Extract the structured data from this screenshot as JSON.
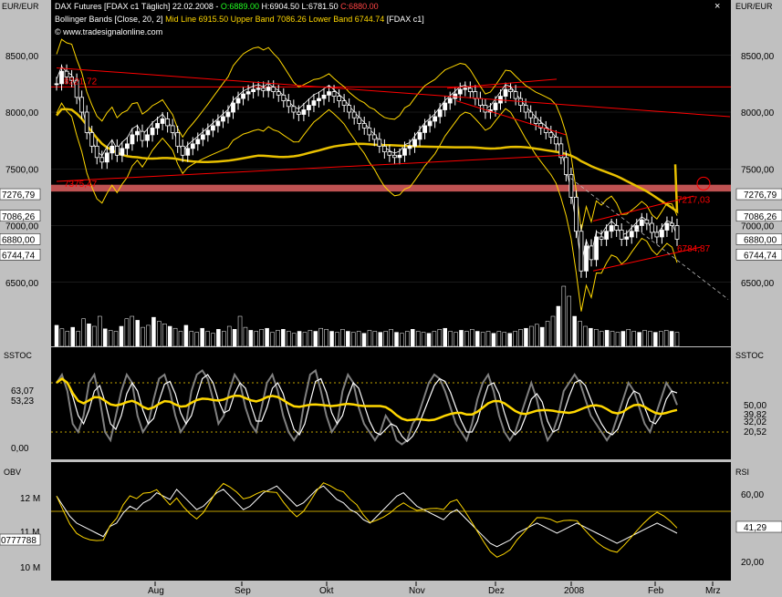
{
  "header": {
    "title_line": "DAX Futures [FDAX c1  Täglich] 22.02.2008 - O:6889.00 H:6904.50 L:6781.50 C:6880.00",
    "title_main": "DAX Futures [FDAX c1  Täglich] 22.02.2008 - ",
    "title_open": "O:6889.00",
    "title_high": "H:6904.50",
    "title_low": "L:6781.50",
    "title_close": "C:6880.00",
    "bollinger_prefix": "Bollinger Bands [Close, 20, 2]",
    "bollinger_values": "Mid Line 6915.50 Upper Band 7086.26 Lower Band 6744.74",
    "bollinger_suffix": "[FDAX c1]",
    "website": "© www.tradesignalonline.com",
    "close_button": "×"
  },
  "axes": {
    "left_unit": "EUR/EUR",
    "right_unit": "EUR/EUR",
    "price_ticks": [
      "8500,00",
      "8000,00",
      "7500,00",
      "7000,00",
      "6500,00"
    ],
    "price_tick_values": [
      8500,
      8000,
      7500,
      7000,
      6500
    ],
    "left_markers": [
      {
        "label": "7276,79",
        "value": 7276.79
      },
      {
        "label": "7086,26",
        "value": 7086.26
      },
      {
        "label": "6880,00",
        "value": 6880
      },
      {
        "label": "6744,74",
        "value": 6744.74
      }
    ],
    "right_markers": [
      {
        "label": "7276,79",
        "value": 7276.79
      },
      {
        "label": "7086,26",
        "value": 7086.26
      },
      {
        "label": "6880,00",
        "value": 6880
      },
      {
        "label": "6744,74",
        "value": 6744.74
      }
    ],
    "months": [
      "Aug",
      "Sep",
      "Okt",
      "Nov",
      "Dez",
      "2008",
      "Feb",
      "Mrz"
    ]
  },
  "annotations": {
    "level_8221": "8221,72",
    "level_7375": "7375,47",
    "level_7217": "7217,03",
    "level_6784": "6784,87"
  },
  "sstoc": {
    "label_left": "SSTOC",
    "label_right": "SSTOC",
    "left_ticks": [
      "63,07",
      "53,23",
      "0,00"
    ],
    "right_ticks": [
      "50,00",
      "39,82",
      "32,02",
      "20,52"
    ]
  },
  "obv_rsi": {
    "label_left": "OBV",
    "label_right": "RSI",
    "left_ticks": [
      "12 M",
      "11 M",
      "10 M"
    ],
    "left_marker": "0777788",
    "right_ticks": [
      "60,00",
      "20,00"
    ],
    "right_marker": "41,29"
  },
  "colors": {
    "background": "#000000",
    "panel": "#c0c0c0",
    "bollinger": "#ffd700",
    "moving_average": "#e8c000",
    "trendline": "#ff0000",
    "resistance_zone": "#e06060",
    "candle_up": "#ffffff",
    "candle_down": "#000000",
    "stoch_fast": "#808080",
    "stoch_slow": "#ffffff",
    "indicator_yellow": "#ffd700"
  },
  "chart_data": [
    {
      "type": "candlestick",
      "title": "DAX Futures [FDAX c1  Täglich]",
      "ylabel": "EUR/EUR",
      "ylim": [
        6000,
        8700
      ],
      "date_range": [
        "2007-07",
        "2008-02-22"
      ],
      "last_bar": {
        "date": "22.02.2008",
        "open": 6889.0,
        "high": 6904.5,
        "low": 6781.5,
        "close": 6880.0
      },
      "bollinger": {
        "period": 20,
        "stddev": 2,
        "mid": 6915.5,
        "upper": 7086.26,
        "lower": 6744.74
      },
      "levels": [
        8221.72,
        7375.47,
        7276.79,
        7217.03,
        6784.87
      ],
      "series": [
        {
          "name": "Close",
          "values": [
            8250,
            8360,
            8310,
            8280,
            8130,
            8000,
            7820,
            7700,
            7600,
            7560,
            7640,
            7700,
            7620,
            7680,
            7720,
            7800,
            7830,
            7750,
            7800,
            7860,
            7900,
            7940,
            7880,
            7820,
            7700,
            7620,
            7680,
            7720,
            7760,
            7800,
            7840,
            7880,
            7920,
            7960,
            8000,
            8080,
            8120,
            8160,
            8180,
            8200,
            8210,
            8190,
            8220,
            8180,
            8150,
            8100,
            8050,
            8000,
            7980,
            8020,
            8060,
            8100,
            8120,
            8150,
            8180,
            8140,
            8100,
            8060,
            8000,
            7950,
            7900,
            7860,
            7800,
            7760,
            7700,
            7650,
            7620,
            7600,
            7620,
            7680,
            7700,
            7760,
            7820,
            7880,
            7920,
            7960,
            8020,
            8080,
            8120,
            8160,
            8200,
            8210,
            8180,
            8120,
            8060,
            8000,
            8020,
            8080,
            8140,
            8200,
            8180,
            8120,
            8060,
            8000,
            7950,
            7900,
            7860,
            7820,
            7780,
            7720,
            7600,
            7450,
            7250,
            6950,
            6600,
            6820,
            6700,
            6900,
            6880,
            6950,
            7000,
            6960,
            6880,
            6900,
            6950,
            7000,
            7050,
            7020,
            6940,
            6900,
            6960,
            7020,
            7000,
            6880
          ]
        }
      ]
    },
    {
      "type": "bar",
      "title": "Volume",
      "values": [
        42,
        35,
        30,
        38,
        30,
        55,
        45,
        40,
        60,
        35,
        32,
        30,
        40,
        55,
        60,
        52,
        38,
        42,
        58,
        50,
        45,
        40,
        36,
        30,
        42,
        30,
        28,
        36,
        30,
        26,
        34,
        30,
        40,
        34,
        60,
        38,
        32,
        30,
        34,
        36,
        28,
        32,
        34,
        30,
        26,
        30,
        28,
        32,
        30,
        36,
        34,
        30,
        28,
        34,
        30,
        28,
        30,
        26,
        32,
        30,
        28,
        30,
        34,
        28,
        26,
        30,
        34,
        30,
        28,
        26,
        30,
        34,
        36,
        30,
        28,
        32,
        30,
        34,
        30,
        28,
        30,
        26,
        30,
        28,
        26,
        30,
        34,
        36,
        40,
        44,
        38,
        50,
        60,
        80,
        120,
        100,
        60,
        50,
        40,
        36,
        34,
        30,
        32,
        30,
        28,
        30,
        34,
        30,
        28,
        32,
        30,
        28,
        30,
        32,
        30,
        28
      ]
    },
    {
      "type": "line",
      "title": "SSTOC",
      "ylim": [
        -10,
        100
      ],
      "series": [
        {
          "name": "SSTOC",
          "values": [
            80,
            90,
            70,
            30,
            20,
            40,
            80,
            90,
            60,
            20,
            10,
            40,
            70,
            90,
            80,
            40,
            20,
            30,
            60,
            85,
            90,
            70,
            40,
            20,
            30,
            70,
            90,
            95,
            85,
            60,
            30,
            40,
            70,
            90,
            80,
            50,
            30,
            20,
            50,
            80,
            90,
            70,
            40,
            20,
            10,
            20,
            60,
            90,
            95,
            70,
            40,
            20,
            30,
            70,
            90,
            80,
            50,
            30,
            20,
            10,
            20,
            40,
            30,
            10,
            5,
            10,
            30,
            40,
            60,
            80,
            90,
            85,
            70,
            50,
            30,
            20,
            10,
            30,
            60,
            80,
            90,
            70,
            40,
            20,
            10,
            20,
            40,
            60,
            80,
            60,
            30,
            10,
            20,
            40,
            70,
            80,
            90,
            80,
            60,
            40,
            30,
            20,
            10,
            20,
            40,
            60,
            80,
            70,
            50,
            30,
            20,
            40,
            60,
            80,
            70,
            53
          ]
        }
      ]
    },
    {
      "type": "line",
      "title": "OBV / RSI",
      "ylim": [
        10,
        13
      ],
      "series": [
        {
          "name": "OBV",
          "values": [
            12.1,
            11.8,
            11.5,
            11.3,
            11.2,
            11.1,
            11.0,
            10.9,
            11.2,
            11.3,
            11.6,
            11.8,
            11.7,
            11.9,
            12.0,
            12.2,
            12.1,
            12.0,
            12.3,
            12.1,
            11.9,
            11.7,
            11.8,
            12.0,
            12.2,
            12.3,
            12.1,
            11.9,
            11.7,
            11.8,
            12.0,
            12.2,
            12.3,
            12.4,
            12.2,
            12.0,
            11.8,
            11.9,
            12.1,
            12.3,
            12.4,
            12.2,
            12.0,
            11.9,
            11.7,
            11.6,
            11.4,
            11.3,
            11.5,
            11.7,
            11.9,
            12.1,
            12.2,
            12.0,
            11.8,
            11.7,
            11.6,
            11.5,
            11.4,
            11.6,
            11.7,
            11.5,
            11.3,
            11.1,
            10.9,
            10.7,
            10.6,
            10.7,
            10.8,
            11.0,
            11.1,
            11.2,
            11.3,
            11.2,
            11.1,
            11.0,
            11.1,
            11.2,
            11.3,
            11.2,
            11.1,
            11.0,
            10.9,
            10.8,
            10.7,
            10.8,
            10.9,
            11.0,
            11.1,
            11.2,
            11.3,
            11.2,
            11.1,
            11.0
          ]
        }
      ]
    }
  ]
}
